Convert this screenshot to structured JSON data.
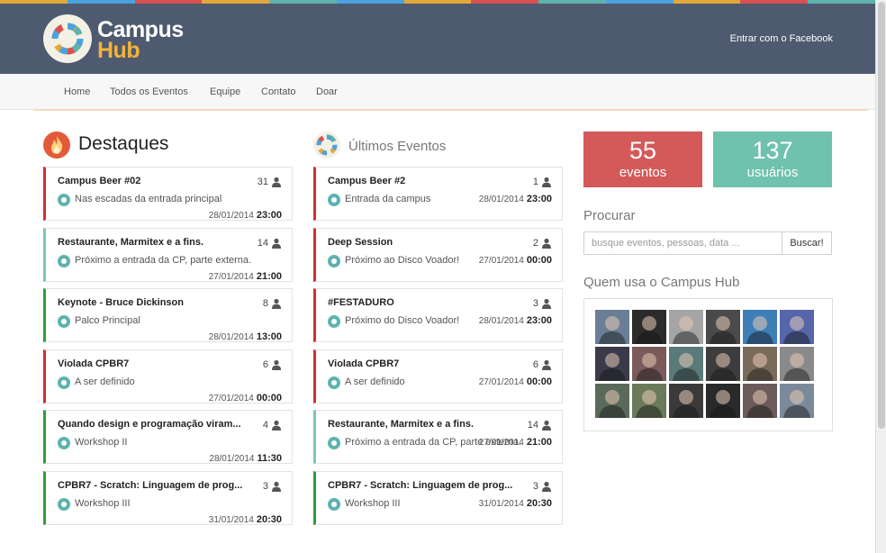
{
  "header": {
    "brand_line1": "Campus",
    "brand_line2": "Hub",
    "login_link": "Entrar com o Facebook",
    "stripe_colors": [
      "#e2a83b",
      "#4aa3df",
      "#d8514f",
      "#e2a83b",
      "#5fb3ae",
      "#4aa3df",
      "#e2a83b",
      "#d8514f",
      "#5fb3ae",
      "#4aa3df",
      "#e2a83b",
      "#d8514f",
      "#5fb3ae"
    ]
  },
  "nav": {
    "items": [
      "Home",
      "Todos os Eventos",
      "Equipe",
      "Contato",
      "Doar"
    ]
  },
  "highlights": {
    "title": "Destaques",
    "events": [
      {
        "title": "Campus Beer #02",
        "count": "31",
        "place": "Nas escadas da entrada principal",
        "date": "28/01/2014",
        "time": "23:00",
        "color": "#d32f2f"
      },
      {
        "title": "Restaurante, Marmitex e a fins.",
        "count": "14",
        "place": "Próximo a entrada da CP, parte externa.",
        "date": "27/01/2014",
        "time": "21:00",
        "color": "#7cc7b8"
      },
      {
        "title": "Keynote - Bruce Dickinson",
        "count": "8",
        "place": "Palco Principal",
        "date": "28/01/2014",
        "time": "13:00",
        "color": "#2e9e3a"
      },
      {
        "title": "Violada CPBR7",
        "count": "6",
        "place": "A ser definido",
        "date": "27/01/2014",
        "time": "00:00",
        "color": "#d32f2f"
      },
      {
        "title": "Quando design e programação viram...",
        "count": "4",
        "place": "Workshop II",
        "date": "28/01/2014",
        "time": "11:30",
        "color": "#2e9e3a"
      },
      {
        "title": "CPBR7 - Scratch: Linguagem de prog...",
        "count": "3",
        "place": "Workshop III",
        "date": "31/01/2014",
        "time": "20:30",
        "color": "#2e9e3a"
      }
    ]
  },
  "latest": {
    "title": "Últimos Eventos",
    "events": [
      {
        "title": "Campus Beer #2",
        "count": "1",
        "place": "Entrada da campus",
        "date": "28/01/2014",
        "time": "23:00",
        "color": "#d32f2f"
      },
      {
        "title": "Deep Session",
        "count": "2",
        "place": "Próximo ao Disco Voador!",
        "date": "27/01/2014",
        "time": "00:00",
        "color": "#d32f2f"
      },
      {
        "title": "#FESTADURO",
        "count": "3",
        "place": "Próximo do Disco Voador!",
        "date": "28/01/2014",
        "time": "23:00",
        "color": "#d32f2f"
      },
      {
        "title": "Violada CPBR7",
        "count": "6",
        "place": "A ser definido",
        "date": "27/01/2014",
        "time": "00:00",
        "color": "#d32f2f"
      },
      {
        "title": "Restaurante, Marmitex e a fins.",
        "count": "14",
        "place": "Próximo a entrada da CP, parte externa.",
        "date": "27/01/2014",
        "time": "21:00",
        "color": "#7cc7b8"
      },
      {
        "title": "CPBR7 - Scratch: Linguagem de prog...",
        "count": "3",
        "place": "Workshop III",
        "date": "31/01/2014",
        "time": "20:30",
        "color": "#2e9e3a"
      }
    ]
  },
  "stats": {
    "events_count": "55",
    "events_label": "eventos",
    "events_color": "#d45a5a",
    "users_count": "137",
    "users_label": "usuários",
    "users_color": "#6fc2ad"
  },
  "search": {
    "label": "Procurar",
    "placeholder": "busque eventos, pessoas, data ...",
    "button": "Buscar!"
  },
  "users_section": {
    "title": "Quem usa o Campus Hub",
    "avatar_tones": [
      [
        "#6a7f96",
        "#2b2b2b",
        "#a5a5a5",
        "#4a4a4a",
        "#3f7fb8",
        "#5566aa"
      ],
      [
        "#3a3a4a",
        "#7a5a5a",
        "#5a7a7a",
        "#3d3d3d",
        "#7a6a5a",
        "#8a8a8a"
      ],
      [
        "#5a6a5a",
        "#6a7a5a",
        "#3a3a3a",
        "#2a2a2a",
        "#6a5a5a",
        "#7a8a9a"
      ]
    ]
  }
}
